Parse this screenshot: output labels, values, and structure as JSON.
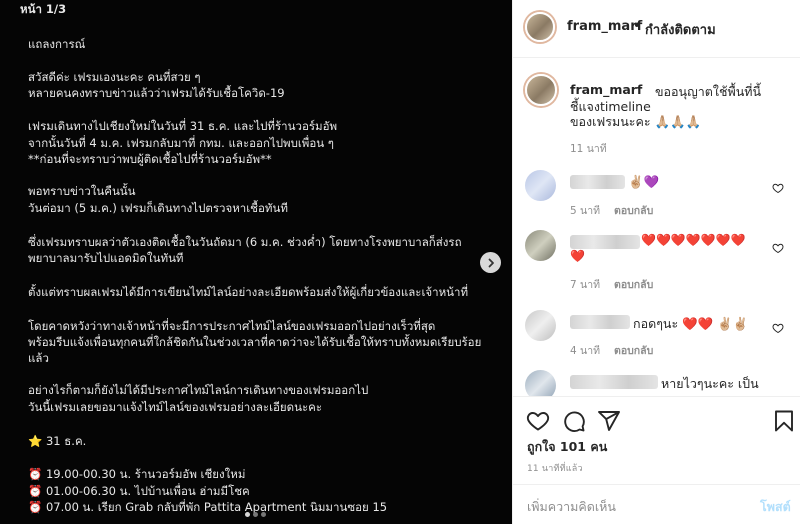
{
  "post_image": {
    "lines": [
      "หน้า 1/3",
      "แถลงการณ์",
      "สวัสดีค่ะ เฟรมเองนะคะ คนที่สวย ๆ",
      "หลายคนคงทราบข่าวแล้วว่าเฟรมได้รับเชื้อโควิด-19",
      "เฟรมเดินทางไปเชียงใหม่ในวันที่ 31 ธ.ค. และไปที่ร้านวอร์มอัพ",
      "จากนั้นวันที่ 4 ม.ค. เฟรมกลับมาที่ กทม. และออกไปพบเพื่อน ๆ",
      "**ก่อนที่จะทราบว่าพบผู้ติดเชื้อไปที่ร้านวอร์มอัพ**",
      "พอทราบข่าวในคืนนั้น",
      "วันต่อมา (5 ม.ค.) เฟรมก็เดินทางไปตรวจหาเชื้อทันที",
      "ซึ่งเฟรมทราบผลว่าตัวเองติดเชื้อในวันถัดมา (6 ม.ค. ช่วงค่ำ) โดยทางโรงพยาบาลก็ส่งรถ",
      "พยาบาลมารับไปแอดมิดในทันที",
      "ตั้งแต่ทราบผลเฟรมได้มีการเขียนไทม์ไลน์อย่างละเอียดพร้อมส่งให้ผู้เกี่ยวข้องและเจ้าหน้าที่",
      "โดยคาดหวังว่าทางเจ้าหน้าที่จะมีการประกาศไทม์ไลน์ของเฟรมออกไปอย่างเร็วที่สุด",
      "พร้อมรีบแจ้งเพื่อนทุกคนที่ใกล้ชิดกันในช่วงเวลาที่คาดว่าจะได้รับเชื้อให้ทราบทั้งหมดเรียบร้อย",
      "แล้ว",
      "อย่างไรก็ตามก็ยังไม่ได้มีประกาศไทม์ไลน์การเดินทางของเฟรมออกไป",
      "วันนี้เฟรมเลยขอมาแจ้งไทม์ไลน์ของเฟรมอย่างละเอียดนะคะ",
      "⭐ 31 ธ.ค.",
      "⏰ 19.00-00.30 น. ร้านวอร์มอัพ เชียงใหม่",
      "⏰ 01.00-06.30 น. ไปบ้านเพื่อน ฮ่ามมีโชค",
      "⏰ 07.00 น. เรียก Grab กลับที่พัก Pattita Apartment นิมมานซอย 15"
    ]
  },
  "header": {
    "username": "fram_marf",
    "separator": "•",
    "follow_label": "กำลังติดตาม"
  },
  "caption": {
    "username": "fram_marf",
    "line1": "ขออนุญาตใช้พื้นที่นี้",
    "line2": "ชี้แจงtimeline",
    "line3": "ของเฟรมนะคะ 🙏🏼🙏🏼🙏🏼",
    "time": "11 นาที"
  },
  "comments": [
    {
      "text": "✌🏼💜",
      "time": "5 นาที",
      "reply": "ตอบกลับ"
    },
    {
      "text": "❤️❤️❤️❤️❤️❤️❤️",
      "text2": "❤️",
      "time": "7 นาที",
      "reply": "ตอบกลับ"
    },
    {
      "text": "กอดๆนะ ❤️❤️ ✌🏼✌🏼",
      "time": "4 นาที",
      "reply": "ตอบกลับ"
    },
    {
      "text": "หายไวๆนะคะ เป็น"
    }
  ],
  "actions": {
    "likes": "ถูกใจ 101 คน",
    "posted_ago": "11 นาทีที่แล้ว"
  },
  "add_comment": {
    "placeholder": "เพิ่มความคิดเห็น",
    "post_label": "โพสต์"
  },
  "icons": [
    "chevron-right-icon",
    "heart-icon",
    "comment-icon",
    "share-icon",
    "bookmark-icon"
  ]
}
